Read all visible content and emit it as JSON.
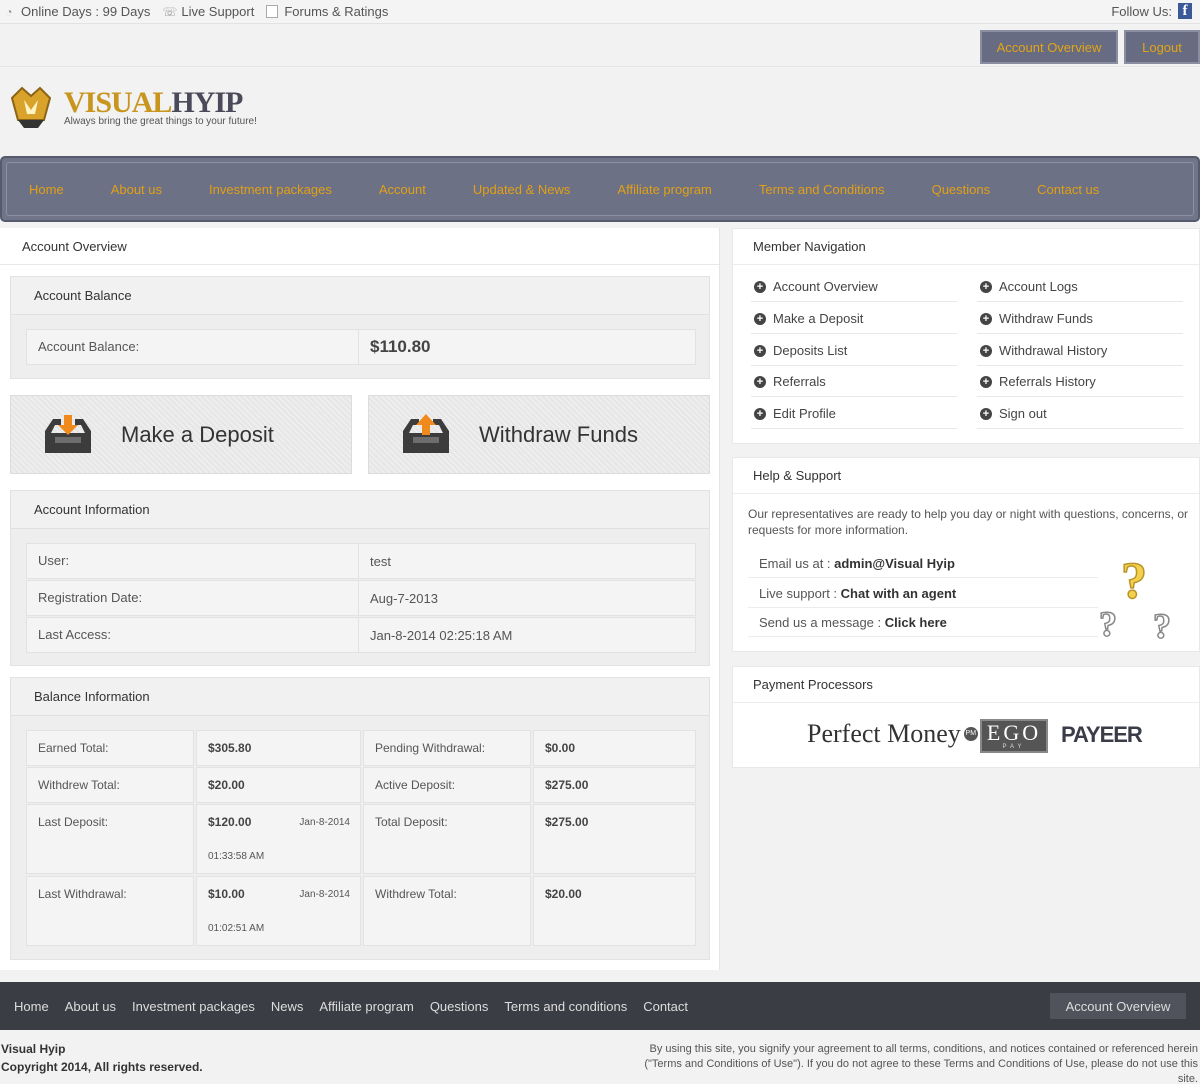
{
  "topbar": {
    "online_days": "Online Days : 99 Days",
    "live_support": "Live Support",
    "forums": "Forums & Ratings",
    "follow_us": "Follow Us:",
    "fb_letter": "f"
  },
  "header": {
    "account_overview_btn": "Account Overview",
    "logout_btn": "Logout",
    "logo_part1": "VISUAL",
    "logo_part2": "HYIP",
    "tagline": "Always bring the great things to your future!"
  },
  "nav": [
    "Home",
    "About us",
    "Investment packages",
    "Account",
    "Updated & News",
    "Affiliate program",
    "Terms and Conditions",
    "Questions",
    "Contact us"
  ],
  "main": {
    "title": "Account Overview",
    "balance_panel": {
      "title": "Account Balance",
      "label": "Account Balance:",
      "value": "$110.80"
    },
    "deposit_btn": "Make a Deposit",
    "withdraw_btn": "Withdraw Funds",
    "info_panel": {
      "title": "Account Information",
      "rows": [
        {
          "label": "User:",
          "value": "test"
        },
        {
          "label": "Registration Date:",
          "value": "Aug-7-2013"
        },
        {
          "label": "Last Access:",
          "value": "Jan-8-2014 02:25:18 AM"
        }
      ]
    },
    "balance_info": {
      "title": "Balance Information",
      "earned_label": "Earned Total:",
      "earned_value": "$305.80",
      "pending_label": "Pending Withdrawal:",
      "pending_value": "$0.00",
      "withdrew_label": "Withdrew Total:",
      "withdrew_value": "$20.00",
      "active_label": "Active Deposit:",
      "active_value": "$275.00",
      "last_dep_label": "Last Deposit:",
      "last_dep_value": "$120.00",
      "last_dep_date": "Jan-8-2014",
      "last_dep_time": "01:33:58 AM",
      "total_dep_label": "Total Deposit:",
      "total_dep_value": "$275.00",
      "last_wd_label": "Last Withdrawal:",
      "last_wd_value": "$10.00",
      "last_wd_date": "Jan-8-2014",
      "last_wd_time": "01:02:51 AM",
      "withdrew2_label": "Withdrew Total:",
      "withdrew2_value": "$20.00"
    }
  },
  "sidebar": {
    "member_nav_title": "Member Navigation",
    "links_left": [
      "Account Overview",
      "Make a Deposit",
      "Deposits List",
      "Referrals",
      "Edit Profile"
    ],
    "links_right": [
      "Account Logs",
      "Withdraw Funds",
      "Withdrawal History",
      "Referrals History",
      "Sign out"
    ],
    "help_title": "Help & Support",
    "help_text": "Our representatives are ready to help you day or night with questions, concerns, or requests for more information.",
    "email_label": "Email us at : ",
    "email_value": "admin@Visual Hyip",
    "live_label": "Live support : ",
    "live_value": "Chat with an agent",
    "msg_label": "Send us a message : ",
    "msg_value": "Click here",
    "payment_title": "Payment Processors",
    "pm_text": "Perfect Money",
    "pm_badge": "PM",
    "ego_text": "EGO",
    "ego_sub": "PAY",
    "payeer_text": "PAYEER"
  },
  "footer": {
    "links": [
      "Home",
      "About us",
      "Investment packages",
      "News",
      "Affiliate program",
      "Questions",
      "Terms and conditions",
      "Contact"
    ],
    "account_overview": "Account Overview",
    "site_name": "Visual Hyip",
    "copyright": "Copyright 2014, All rights reserved.",
    "terms": "By using this site, you signify your agreement to all terms, conditions, and notices contained or referenced herein (\"Terms and Conditions of Use\"). If you do not agree to these Terms and Conditions of Use, please do not use this site."
  },
  "colors": {
    "nav_bg": "#6c7186",
    "nav_text": "#e2a014",
    "footer_bg": "#3b3d45",
    "accent_orange": "#f08a1c"
  }
}
